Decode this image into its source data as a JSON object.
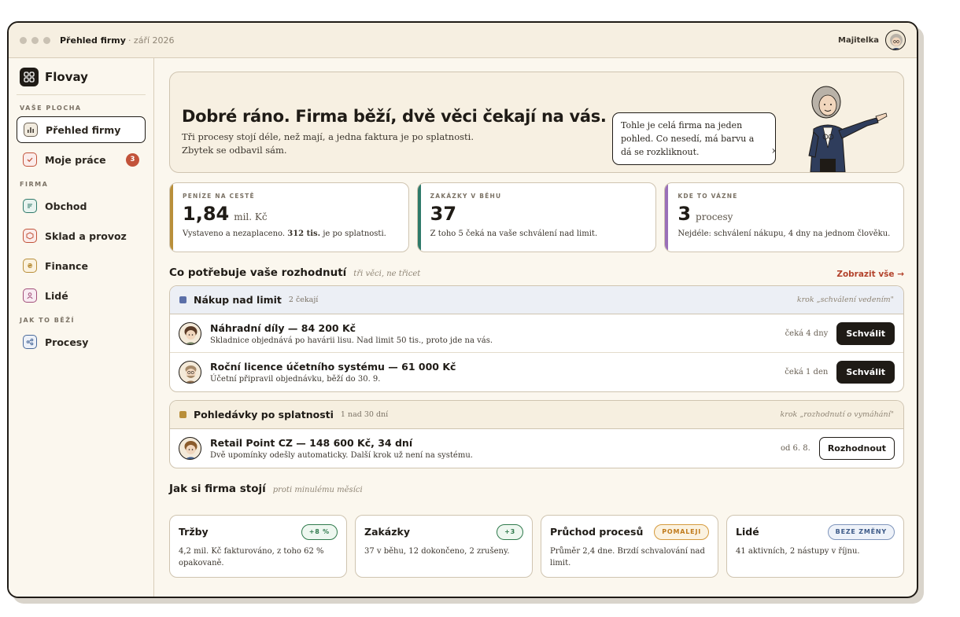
{
  "window": {
    "title": "Přehled firmy",
    "subtitle": "· září 2026",
    "user": "Majitelka"
  },
  "sidebar": {
    "brand": "Flovay",
    "sections": [
      {
        "label": "VAŠE PLOCHA"
      },
      {
        "label": "FIRMA"
      },
      {
        "label": "JAK TO BĚŽÍ"
      }
    ],
    "items": [
      {
        "label": "Přehled firmy"
      },
      {
        "label": "Moje práce",
        "badge": "3"
      },
      {
        "label": "Obchod"
      },
      {
        "label": "Sklad a provoz"
      },
      {
        "label": "Finance"
      },
      {
        "label": "Lidé"
      },
      {
        "label": "Procesy"
      }
    ]
  },
  "hero": {
    "title": "Dobré ráno. Firma běží, dvě věci čekají na vás.",
    "text": "Tři procesy stojí déle, než mají, a jedna faktura je po splatnosti. Zbytek se odbavil sám.",
    "bubble": "Tohle je celá firma na jeden pohled. Co nesedí, má barvu a dá se rozkliknout."
  },
  "stats": [
    {
      "label": "PENÍZE NA CESTĚ",
      "value": "1,84",
      "unit": "mil. Kč",
      "desc_pre": "Vystaveno a nezaplaceno. ",
      "desc_bold": "312 tis.",
      "desc_post": " je po splatnosti.",
      "accent": "#b98f3a"
    },
    {
      "label": "ZAKÁZKY V BĚHU",
      "value": "37",
      "unit": "",
      "desc": "Z toho 5 čeká na vaše schválení nad limit.",
      "accent": "#2f7a6a"
    },
    {
      "label": "KDE TO VÁZNE",
      "value": "3",
      "unit": "procesy",
      "desc": "Nejdéle: schválení nákupu, 4 dny na jednom člověku.",
      "accent": "#9a6fb8"
    }
  ],
  "decisions": {
    "title": "Co potřebuje vaše rozhodnutí",
    "subtitle": "tři věci, ne třicet",
    "link": "Zobrazit vše →",
    "groups": [
      {
        "title": "Nákup nad limit",
        "count": "2 čekají",
        "step": "krok „schválení vedením\"",
        "color": "#5b6fa8",
        "rows": [
          {
            "title": "Náhradní díly — 84 200 Kč",
            "desc": "Skladnice objednává po havárii lisu. Nad limit 50 tis., proto jde na vás.",
            "wait": "čeká 4 dny",
            "action": "Schválit"
          },
          {
            "title": "Roční licence účetního systému — 61 000 Kč",
            "desc": "Účetní připravil objednávku, běží do 30. 9.",
            "wait": "čeká 1 den",
            "action": "Schválit"
          }
        ]
      },
      {
        "title": "Pohledávky po splatnosti",
        "count": "1 nad 30 dní",
        "step": "krok „rozhodnutí o vymáhání\"",
        "color": "#b98f3a",
        "rows": [
          {
            "title": "Retail Point CZ — 148 600 Kč, 34 dní",
            "desc": "Dvě upomínky odešly automaticky. Další krok už není na systému.",
            "wait": "od 6. 8.",
            "action": "Rozhodnout"
          }
        ]
      }
    ]
  },
  "health": {
    "title": "Jak si firma stojí",
    "subtitle": "proti minulému měsíci",
    "cards": [
      {
        "title": "Tržby",
        "pill": "+8 %",
        "desc": "4,2 mil. Kč fakturováno, z toho 62 % opakovaně."
      },
      {
        "title": "Zakázky",
        "pill": "+3",
        "desc": "37 v běhu, 12 dokončeno, 2 zrušeny."
      },
      {
        "title": "Průchod procesů",
        "pill": "POMALEJI",
        "desc": "Průměr 2,4 dne. Brzdí schvalování nad limit."
      },
      {
        "title": "Lidé",
        "pill": "BEZE ZMĚNY",
        "desc": "41 aktivních, 2 nástupy v říjnu."
      }
    ]
  }
}
